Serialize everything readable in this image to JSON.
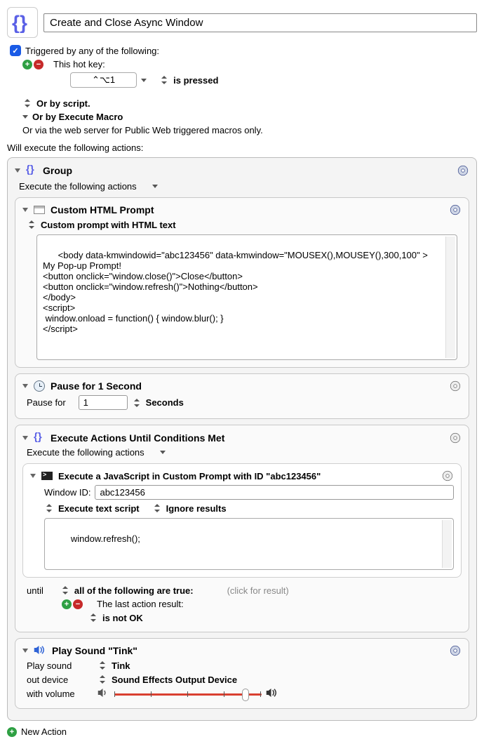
{
  "header": {
    "macro_title": "Create and Close Async Window"
  },
  "trigger": {
    "enabled_label": "Triggered by any of the following:",
    "hotkey_label": "This hot key:",
    "hotkey_value": "⌃⌥1",
    "is_pressed": "is pressed",
    "by_script": "Or by script.",
    "by_execute_macro": "Or by Execute Macro",
    "by_web_server": "Or via the web server for Public Web triggered macros only."
  },
  "will_execute": "Will execute the following actions:",
  "group": {
    "title": "Group",
    "subtitle": "Execute the following actions"
  },
  "custom_html": {
    "title": "Custom HTML Prompt",
    "mode": "Custom prompt with HTML text",
    "code": "<body data-kmwindowid=\"abc123456\" data-kmwindow=\"MOUSEX(),MOUSEY(),300,100\" >\nMy Pop-up Prompt!\n<button onclick=\"window.close()\">Close</button>\n<button onclick=\"window.refresh()\">Nothing</button>\n</body>\n<script>\n window.onload = function() { window.blur(); }\n</script>"
  },
  "pause": {
    "title": "Pause for 1 Second",
    "label": "Pause for",
    "value": "1",
    "unit": "Seconds"
  },
  "until_loop": {
    "title": "Execute Actions Until Conditions Met",
    "subtitle": "Execute the following actions",
    "js_action": {
      "title": "Execute a JavaScript in Custom Prompt with ID \"abc123456\"",
      "window_id_label": "Window ID:",
      "window_id": "abc123456",
      "mode1": "Execute text script",
      "mode2": "Ignore results",
      "code": "window.refresh();"
    },
    "until_label": "until",
    "all_true": "all of the following are true:",
    "result_hint": "(click for result)",
    "cond_label": "The last action result:",
    "cond_op": "is not OK"
  },
  "sound": {
    "title": "Play Sound \"Tink\"",
    "play_label": "Play sound",
    "sound_name": "Tink",
    "device_label": "out device",
    "device_name": "Sound Effects Output Device",
    "volume_label": "with volume"
  },
  "footer": {
    "new_action": "New Action"
  }
}
